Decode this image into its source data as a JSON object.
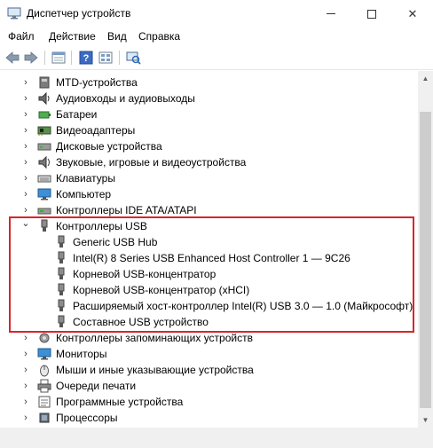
{
  "window": {
    "title": "Диспетчер устройств",
    "minimize_glyph": "",
    "close_glyph": "✕"
  },
  "menu": [
    "Файл",
    "Действие",
    "Вид",
    "Справка"
  ],
  "toolbar": {
    "buttons": [
      "back-arrow-icon",
      "forward-arrow-icon",
      "properties-icon",
      "help-icon",
      "view-icon",
      "scan-hardware-icon"
    ]
  },
  "tree": {
    "categories_top": [
      {
        "label": "MTD-устройства",
        "icon": "mtd-icon"
      },
      {
        "label": "Аудиовходы и аудиовыходы",
        "icon": "audio-icon"
      },
      {
        "label": "Батареи",
        "icon": "battery-icon"
      },
      {
        "label": "Видеоадаптеры",
        "icon": "display-adapter-icon"
      },
      {
        "label": "Дисковые устройства",
        "icon": "disk-icon"
      },
      {
        "label": "Звуковые, игровые и видеоустройства",
        "icon": "sound-icon"
      },
      {
        "label": "Клавиатуры",
        "icon": "keyboard-icon"
      },
      {
        "label": "Компьютер",
        "icon": "computer-icon"
      },
      {
        "label": "Контроллеры IDE ATA/ATAPI",
        "icon": "ide-icon"
      }
    ],
    "usb": {
      "label": "Контроллеры USB",
      "expand_glyph": "⌄",
      "children": [
        "Generic USB Hub",
        "Intel(R) 8 Series USB Enhanced Host Controller 1  — 9C26",
        "Корневой USB-концентратор",
        "Корневой USB-концентратор (xHCI)",
        "Расширяемый хост-контроллер Intel(R) USB 3.0 — 1.0 (Майкрософт)",
        "Составное USB устройство"
      ]
    },
    "categories_bottom": [
      {
        "label": "Контроллеры запоминающих устройств",
        "icon": "storage-controller-icon"
      },
      {
        "label": "Мониторы",
        "icon": "monitor-icon"
      },
      {
        "label": "Мыши и иные указывающие устройства",
        "icon": "mouse-icon"
      },
      {
        "label": "Очереди печати",
        "icon": "printer-icon"
      },
      {
        "label": "Программные устройства",
        "icon": "software-device-icon"
      },
      {
        "label": "Процессоры",
        "icon": "processor-icon"
      }
    ],
    "collapsed_glyph": "›"
  },
  "colors": {
    "highlight_border": "#d7262b"
  }
}
